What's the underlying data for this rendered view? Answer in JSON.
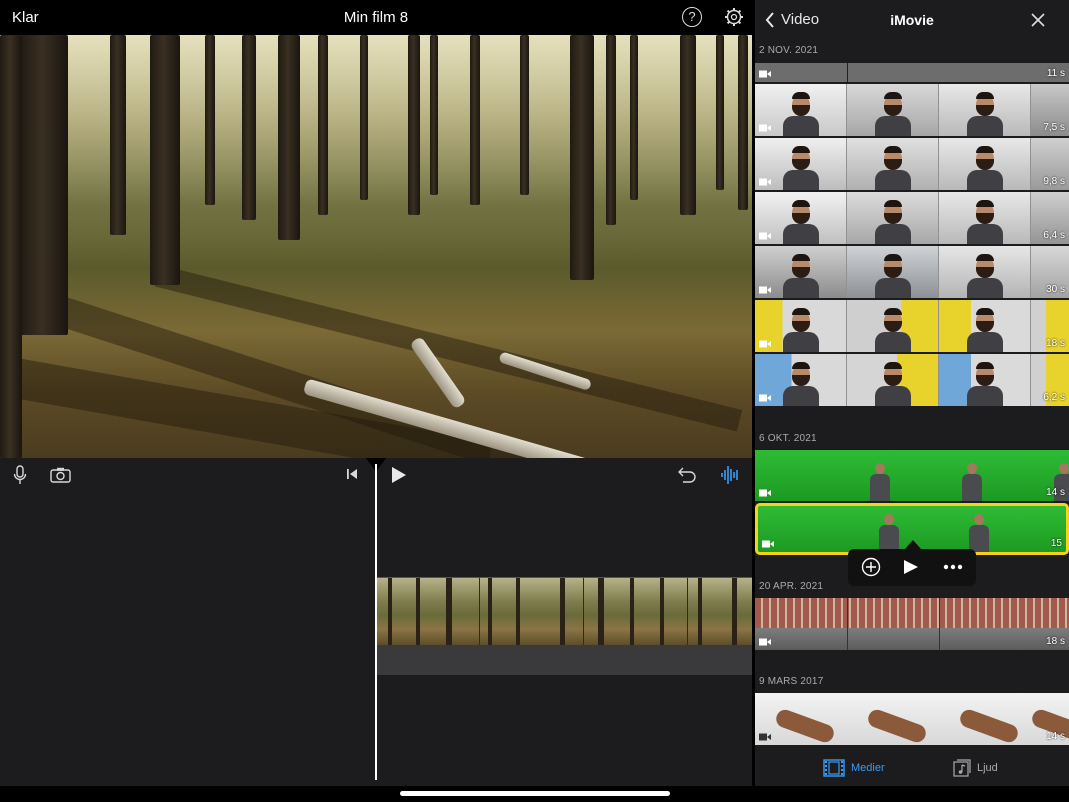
{
  "editor": {
    "done_label": "Klar",
    "project_title": "Min film 8",
    "help_symbol": "?",
    "settings_icon": "gear-icon"
  },
  "toolbar": {
    "mic_icon": "microphone-icon",
    "camera_icon": "camera-icon",
    "rewind_icon": "skip-to-start-icon",
    "play_icon": "play-icon",
    "undo_icon": "undo-icon",
    "audio_icon": "audio-waveform-icon"
  },
  "browser": {
    "back_label": "Video",
    "title": "iMovie",
    "sections": [
      {
        "date": "2 NOV. 2021",
        "clips": [
          "11 s",
          "7,5 s",
          "9,8 s",
          "6,4 s",
          "30 s",
          "18 s",
          "6,2 s"
        ]
      },
      {
        "date": "6 OKT. 2021",
        "clips": [
          "14 s",
          "15"
        ]
      },
      {
        "date": "20 APR. 2021",
        "clips": [
          "18 s"
        ]
      },
      {
        "date": "9 MARS 2017",
        "clips": [
          "14 s"
        ]
      }
    ],
    "tabs": {
      "media": "Medier",
      "audio": "Ljud"
    },
    "accent_color": "#3a9bf3",
    "selection_color": "#f6d31a"
  }
}
